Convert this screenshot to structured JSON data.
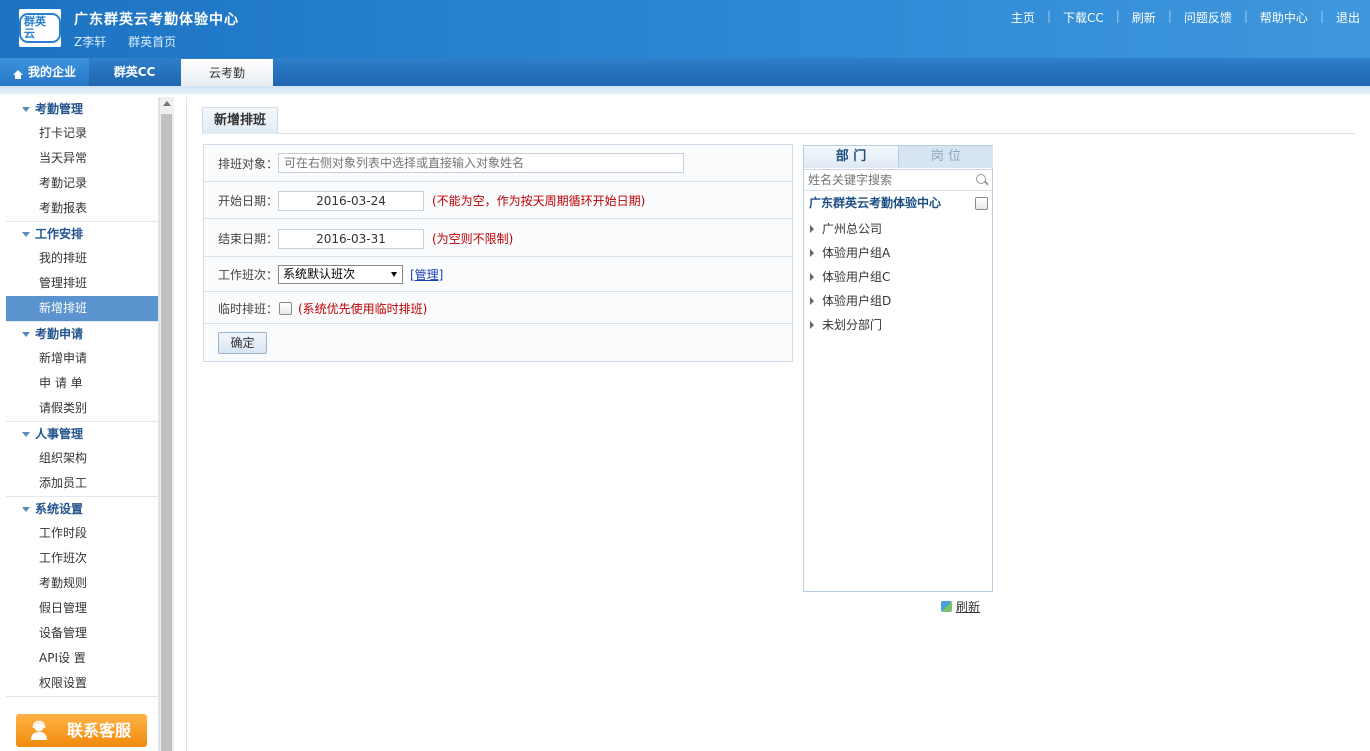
{
  "header": {
    "logo_text": "群英云",
    "org_title": "广东群英云考勤体验中心",
    "user_name": "Z李轩",
    "home_link": "群英首页",
    "nav": [
      "主页",
      "下载CC",
      "刷新",
      "问题反馈",
      "帮助中心",
      "退出"
    ],
    "separator": "|"
  },
  "tabs": {
    "my_company": "我的企业",
    "qunying_cc": "群英CC",
    "cloud_attendance": "云考勤"
  },
  "sidebar": {
    "groups": [
      {
        "title": "考勤管理",
        "items": [
          "打卡记录",
          "当天异常",
          "考勤记录",
          "考勤报表"
        ]
      },
      {
        "title": "工作安排",
        "items": [
          "我的排班",
          "管理排班",
          "新增排班"
        ]
      },
      {
        "title": "考勤申请",
        "items": [
          "新增申请",
          "申 请 单",
          "请假类别"
        ]
      },
      {
        "title": "人事管理",
        "items": [
          "组织架构",
          "添加员工"
        ]
      },
      {
        "title": "系统设置",
        "items": [
          "工作时段",
          "工作班次",
          "考勤规则",
          "假日管理",
          "设备管理",
          "API设 置",
          "权限设置"
        ]
      }
    ],
    "active_item": "新增排班",
    "customer_service": "联系客服"
  },
  "main": {
    "page_title": "新增排班",
    "form": {
      "target_label": "排班对象：",
      "target_placeholder": "可在右侧对象列表中选择或直接输入对象姓名",
      "start_label": "开始日期：",
      "start_value": "2016-03-24",
      "start_hint": "(不能为空，作为按天周期循环开始日期)",
      "end_label": "结束日期：",
      "end_value": "2016-03-31",
      "end_hint": "(为空则不限制)",
      "shift_label": "工作班次：",
      "shift_value": "系统默认班次",
      "manage_link": "[管理]",
      "temp_label": "临时排班：",
      "temp_checked": false,
      "temp_hint": "(系统优先使用临时排班)",
      "confirm_button": "确定"
    },
    "tree_panel": {
      "tab_department": "部 门",
      "tab_position": "岗 位",
      "search_placeholder": "姓名关键字搜索",
      "root": "广东群英云考勤体验中心",
      "nodes": [
        "广州总公司",
        "体验用户组A",
        "体验用户组C",
        "体验用户组D",
        "未划分部门"
      ],
      "refresh": "刷新"
    }
  },
  "colors": {
    "header_blue": "#2a86d4",
    "active_menu": "#5b93cf",
    "hint_red": "#c00000",
    "cs_orange": "#f08a0c"
  }
}
